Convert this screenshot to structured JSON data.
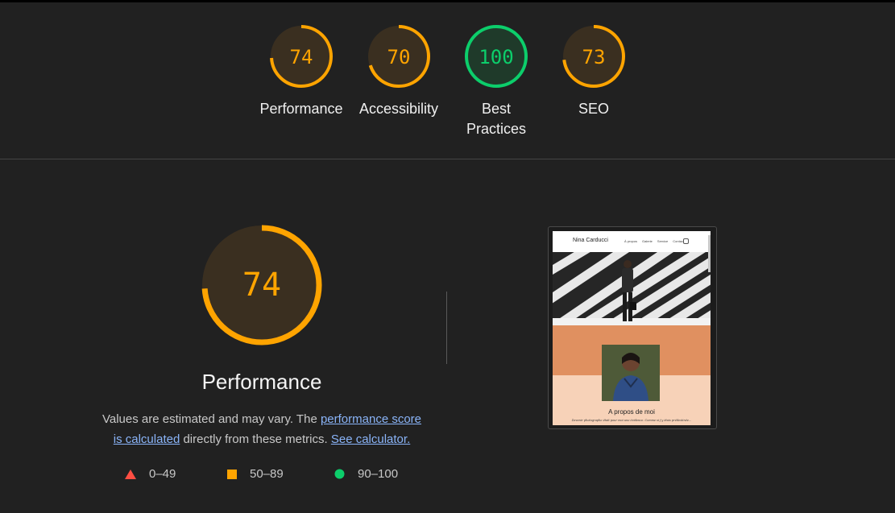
{
  "summary_gauges": [
    {
      "score": "74",
      "label": "Performance",
      "value": 74,
      "color": "#ffa400"
    },
    {
      "score": "70",
      "label": "Accessibility",
      "value": 70,
      "color": "#ffa400"
    },
    {
      "score": "100",
      "label_line1": "Best",
      "label_line2": "Practices",
      "value": 100,
      "color": "#0cce6b"
    },
    {
      "score": "73",
      "label": "SEO",
      "value": 73,
      "color": "#ffa400"
    }
  ],
  "performance": {
    "score": "74",
    "value": 74,
    "color": "#ffa400",
    "title": "Performance",
    "desc_part1": "Values are estimated and may vary. The ",
    "link_score": "performance score is calculated",
    "link_score_a": "performance score",
    "link_score_b": "is calculated",
    "desc_part2": " directly from these metrics. ",
    "link_calculator": "See calculator."
  },
  "legend": [
    {
      "range": "0–49",
      "shape": "triangle-icon",
      "color": "#ff4e42"
    },
    {
      "range": "50–89",
      "shape": "square-icon",
      "color": "#ffa400"
    },
    {
      "range": "90–100",
      "shape": "circle-icon",
      "color": "#0cce6b"
    }
  ],
  "screenshot": {
    "brand": "Nina Carducci",
    "nav": [
      "À propos",
      "Galerie",
      "Service",
      "Contact"
    ],
    "about_title": "A propos de moi",
    "about_text": "Devenir photographe était pour moi une évidence. Comme si j'y étais prédestinée..."
  }
}
